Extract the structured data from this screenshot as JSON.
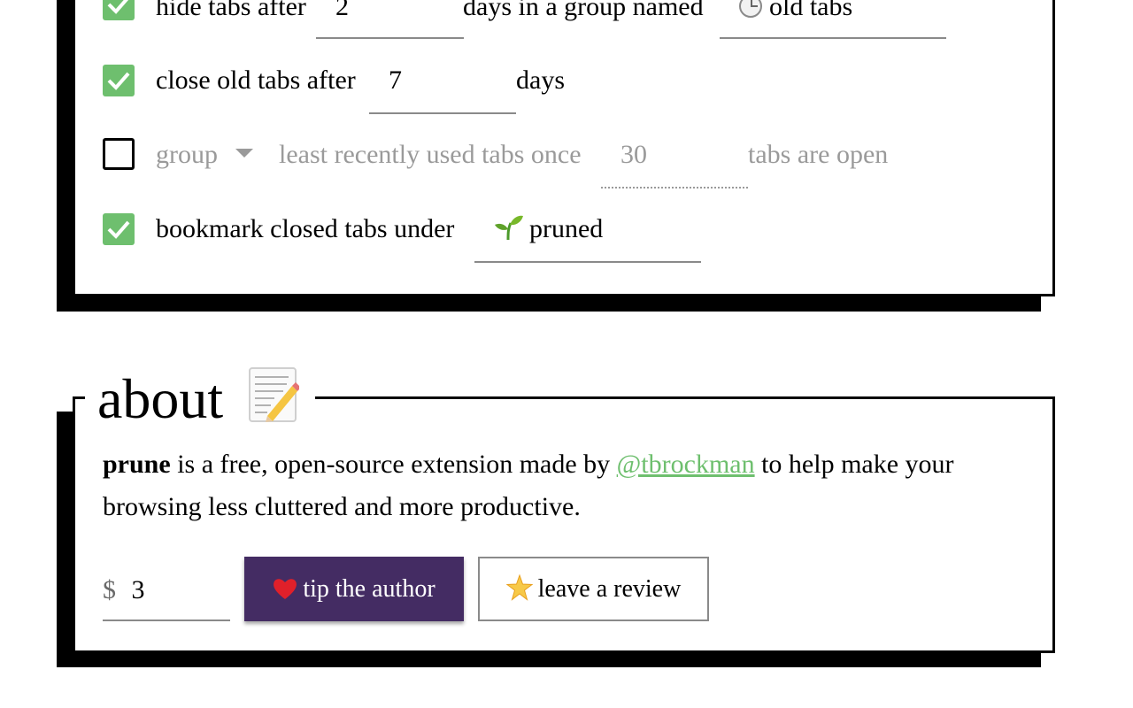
{
  "settings": {
    "hide_row": {
      "checked": true,
      "label_before": "hide tabs after",
      "days_value": "2",
      "label_middle": "days in a group named",
      "group_name": "old tabs",
      "group_icon": "clock-icon"
    },
    "close_row": {
      "checked": true,
      "label_before": "close old tabs after",
      "days_value": "7",
      "label_after": "days"
    },
    "group_row": {
      "checked": false,
      "action_select": "group",
      "label_middle": "least recently used tabs once",
      "count_value": "30",
      "label_after": "tabs are open"
    },
    "bookmark_row": {
      "checked": true,
      "label": "bookmark closed tabs under",
      "folder_icon": "seedling-icon",
      "folder_name": "pruned"
    }
  },
  "about": {
    "title": "about",
    "title_icon": "memo-icon",
    "app_name": "prune",
    "text_before_link": " is a free, open-source extension made by ",
    "author_link": "@tbrockman",
    "text_after_link": " to help make your browsing less cluttered and more productive.",
    "currency": "$",
    "tip_amount": "3",
    "tip_button": "tip the author",
    "tip_icon": "heart-icon",
    "review_button": "leave a review",
    "review_icon": "star-icon"
  },
  "colors": {
    "accent_green": "#6ebf6e",
    "button_purple": "#442c63",
    "muted_gray": "#9a9a9a"
  }
}
